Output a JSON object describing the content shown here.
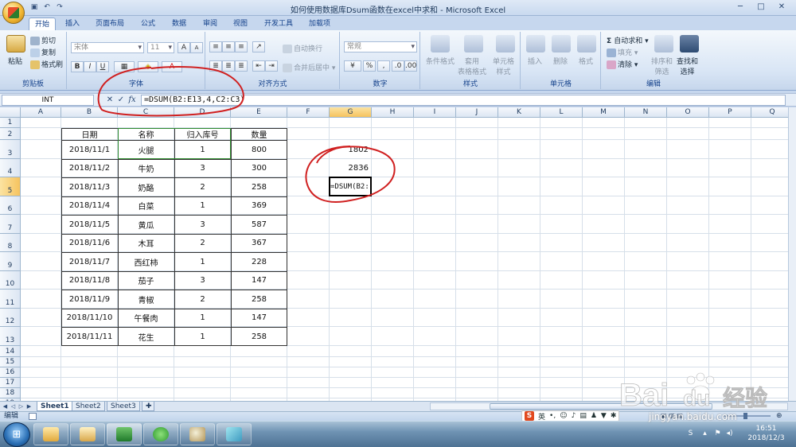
{
  "window": {
    "title": "如何使用数据库Dsum函数在excel中求和 - Microsoft Excel",
    "controls": [
      "─",
      "□",
      "✕"
    ]
  },
  "tabs": [
    "开始",
    "插入",
    "页面布局",
    "公式",
    "数据",
    "审阅",
    "视图",
    "开发工具",
    "加载项"
  ],
  "ribbon": {
    "clipboard": {
      "label": "剪贴板",
      "paste": "粘贴",
      "cut": "剪切",
      "copy": "复制",
      "format_painter": "格式刷"
    },
    "font": {
      "label": "字体",
      "font_name": "宋体",
      "font_size": "11",
      "grow": "A",
      "shrink": "A",
      "bold": "B",
      "italic": "I",
      "underline": "U"
    },
    "alignment": {
      "label": "对齐方式",
      "wrap": "自动换行",
      "merge": "合并后居中"
    },
    "number": {
      "label": "数字",
      "format": "常规",
      "percent": "%",
      "comma": ","
    },
    "styles": {
      "label": "样式",
      "conditional": "条件格式",
      "table": "套用\n表格格式",
      "cell_styles": "单元格\n样式"
    },
    "cells": {
      "label": "单元格",
      "insert": "插入",
      "delete": "删除",
      "format": "格式"
    },
    "editing": {
      "label": "编辑",
      "autosum": "自动求和",
      "fill": "填充",
      "clear": "清除",
      "sort": "排序和\n筛选",
      "find": "查找和\n选择"
    }
  },
  "formula_bar": {
    "name_box": "INT",
    "cancel": "✕",
    "enter": "✓",
    "fx": "fx",
    "formula": "=DSUM(B2:E13,4,C2:C3)"
  },
  "columns": [
    "A",
    "B",
    "C",
    "D",
    "E",
    "F",
    "G",
    "H",
    "I",
    "J",
    "K",
    "L",
    "M",
    "N",
    "O",
    "P",
    "Q"
  ],
  "rows": [
    "1",
    "2",
    "3",
    "4",
    "5",
    "6",
    "7",
    "8",
    "9",
    "10",
    "11",
    "12",
    "13",
    "14",
    "15",
    "16",
    "17",
    "18",
    "19"
  ],
  "table": {
    "headers": [
      "日期",
      "名称",
      "归入库号",
      "数量"
    ],
    "rows": [
      [
        "2018/11/1",
        "火腿",
        "1",
        "800"
      ],
      [
        "2018/11/2",
        "牛奶",
        "3",
        "300"
      ],
      [
        "2018/11/3",
        "奶酪",
        "2",
        "258"
      ],
      [
        "2018/11/4",
        "白菜",
        "1",
        "369"
      ],
      [
        "2018/11/5",
        "黄瓜",
        "3",
        "587"
      ],
      [
        "2018/11/6",
        "木耳",
        "2",
        "367"
      ],
      [
        "2018/11/7",
        "西红柿",
        "1",
        "228"
      ],
      [
        "2018/11/8",
        "茄子",
        "3",
        "147"
      ],
      [
        "2018/11/9",
        "青椒",
        "2",
        "258"
      ],
      [
        "2018/11/10",
        "午餐肉",
        "1",
        "147"
      ],
      [
        "2018/11/11",
        "花生",
        "1",
        "258"
      ]
    ]
  },
  "g_column": {
    "g3": "1802",
    "g4": "2836",
    "g5": "=DSUM(B2:"
  },
  "sheets": [
    "Sheet1",
    "Sheet2",
    "Sheet3"
  ],
  "status": {
    "mode": "编辑",
    "ime_lang": "英"
  },
  "taskbar": {
    "time": "16:51",
    "date": "2018/12/3"
  },
  "watermark": {
    "brand": "Bai",
    "brand_suffix": "du",
    "product": "经验",
    "url": "jingyan.baidu.com"
  }
}
